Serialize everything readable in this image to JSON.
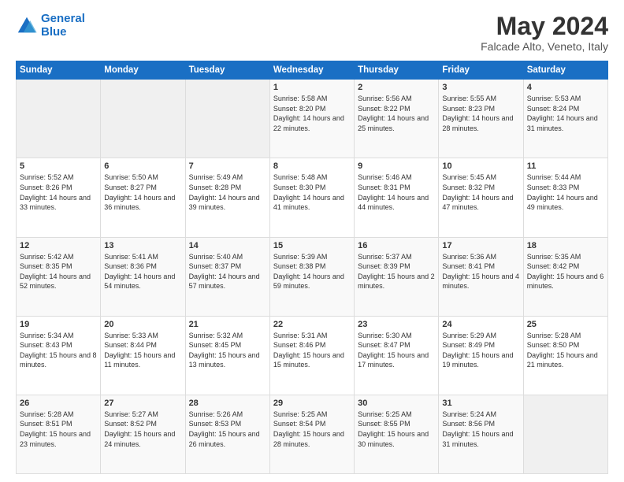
{
  "logo": {
    "line1": "General",
    "line2": "Blue"
  },
  "title": "May 2024",
  "subtitle": "Falcade Alto, Veneto, Italy",
  "weekdays": [
    "Sunday",
    "Monday",
    "Tuesday",
    "Wednesday",
    "Thursday",
    "Friday",
    "Saturday"
  ],
  "weeks": [
    [
      {
        "day": "",
        "sunrise": "",
        "sunset": "",
        "daylight": "",
        "empty": true
      },
      {
        "day": "",
        "sunrise": "",
        "sunset": "",
        "daylight": "",
        "empty": true
      },
      {
        "day": "",
        "sunrise": "",
        "sunset": "",
        "daylight": "",
        "empty": true
      },
      {
        "day": "1",
        "sunrise": "Sunrise: 5:58 AM",
        "sunset": "Sunset: 8:20 PM",
        "daylight": "Daylight: 14 hours and 22 minutes."
      },
      {
        "day": "2",
        "sunrise": "Sunrise: 5:56 AM",
        "sunset": "Sunset: 8:22 PM",
        "daylight": "Daylight: 14 hours and 25 minutes."
      },
      {
        "day": "3",
        "sunrise": "Sunrise: 5:55 AM",
        "sunset": "Sunset: 8:23 PM",
        "daylight": "Daylight: 14 hours and 28 minutes."
      },
      {
        "day": "4",
        "sunrise": "Sunrise: 5:53 AM",
        "sunset": "Sunset: 8:24 PM",
        "daylight": "Daylight: 14 hours and 31 minutes."
      }
    ],
    [
      {
        "day": "5",
        "sunrise": "Sunrise: 5:52 AM",
        "sunset": "Sunset: 8:26 PM",
        "daylight": "Daylight: 14 hours and 33 minutes."
      },
      {
        "day": "6",
        "sunrise": "Sunrise: 5:50 AM",
        "sunset": "Sunset: 8:27 PM",
        "daylight": "Daylight: 14 hours and 36 minutes."
      },
      {
        "day": "7",
        "sunrise": "Sunrise: 5:49 AM",
        "sunset": "Sunset: 8:28 PM",
        "daylight": "Daylight: 14 hours and 39 minutes."
      },
      {
        "day": "8",
        "sunrise": "Sunrise: 5:48 AM",
        "sunset": "Sunset: 8:30 PM",
        "daylight": "Daylight: 14 hours and 41 minutes."
      },
      {
        "day": "9",
        "sunrise": "Sunrise: 5:46 AM",
        "sunset": "Sunset: 8:31 PM",
        "daylight": "Daylight: 14 hours and 44 minutes."
      },
      {
        "day": "10",
        "sunrise": "Sunrise: 5:45 AM",
        "sunset": "Sunset: 8:32 PM",
        "daylight": "Daylight: 14 hours and 47 minutes."
      },
      {
        "day": "11",
        "sunrise": "Sunrise: 5:44 AM",
        "sunset": "Sunset: 8:33 PM",
        "daylight": "Daylight: 14 hours and 49 minutes."
      }
    ],
    [
      {
        "day": "12",
        "sunrise": "Sunrise: 5:42 AM",
        "sunset": "Sunset: 8:35 PM",
        "daylight": "Daylight: 14 hours and 52 minutes."
      },
      {
        "day": "13",
        "sunrise": "Sunrise: 5:41 AM",
        "sunset": "Sunset: 8:36 PM",
        "daylight": "Daylight: 14 hours and 54 minutes."
      },
      {
        "day": "14",
        "sunrise": "Sunrise: 5:40 AM",
        "sunset": "Sunset: 8:37 PM",
        "daylight": "Daylight: 14 hours and 57 minutes."
      },
      {
        "day": "15",
        "sunrise": "Sunrise: 5:39 AM",
        "sunset": "Sunset: 8:38 PM",
        "daylight": "Daylight: 14 hours and 59 minutes."
      },
      {
        "day": "16",
        "sunrise": "Sunrise: 5:37 AM",
        "sunset": "Sunset: 8:39 PM",
        "daylight": "Daylight: 15 hours and 2 minutes."
      },
      {
        "day": "17",
        "sunrise": "Sunrise: 5:36 AM",
        "sunset": "Sunset: 8:41 PM",
        "daylight": "Daylight: 15 hours and 4 minutes."
      },
      {
        "day": "18",
        "sunrise": "Sunrise: 5:35 AM",
        "sunset": "Sunset: 8:42 PM",
        "daylight": "Daylight: 15 hours and 6 minutes."
      }
    ],
    [
      {
        "day": "19",
        "sunrise": "Sunrise: 5:34 AM",
        "sunset": "Sunset: 8:43 PM",
        "daylight": "Daylight: 15 hours and 8 minutes."
      },
      {
        "day": "20",
        "sunrise": "Sunrise: 5:33 AM",
        "sunset": "Sunset: 8:44 PM",
        "daylight": "Daylight: 15 hours and 11 minutes."
      },
      {
        "day": "21",
        "sunrise": "Sunrise: 5:32 AM",
        "sunset": "Sunset: 8:45 PM",
        "daylight": "Daylight: 15 hours and 13 minutes."
      },
      {
        "day": "22",
        "sunrise": "Sunrise: 5:31 AM",
        "sunset": "Sunset: 8:46 PM",
        "daylight": "Daylight: 15 hours and 15 minutes."
      },
      {
        "day": "23",
        "sunrise": "Sunrise: 5:30 AM",
        "sunset": "Sunset: 8:47 PM",
        "daylight": "Daylight: 15 hours and 17 minutes."
      },
      {
        "day": "24",
        "sunrise": "Sunrise: 5:29 AM",
        "sunset": "Sunset: 8:49 PM",
        "daylight": "Daylight: 15 hours and 19 minutes."
      },
      {
        "day": "25",
        "sunrise": "Sunrise: 5:28 AM",
        "sunset": "Sunset: 8:50 PM",
        "daylight": "Daylight: 15 hours and 21 minutes."
      }
    ],
    [
      {
        "day": "26",
        "sunrise": "Sunrise: 5:28 AM",
        "sunset": "Sunset: 8:51 PM",
        "daylight": "Daylight: 15 hours and 23 minutes."
      },
      {
        "day": "27",
        "sunrise": "Sunrise: 5:27 AM",
        "sunset": "Sunset: 8:52 PM",
        "daylight": "Daylight: 15 hours and 24 minutes."
      },
      {
        "day": "28",
        "sunrise": "Sunrise: 5:26 AM",
        "sunset": "Sunset: 8:53 PM",
        "daylight": "Daylight: 15 hours and 26 minutes."
      },
      {
        "day": "29",
        "sunrise": "Sunrise: 5:25 AM",
        "sunset": "Sunset: 8:54 PM",
        "daylight": "Daylight: 15 hours and 28 minutes."
      },
      {
        "day": "30",
        "sunrise": "Sunrise: 5:25 AM",
        "sunset": "Sunset: 8:55 PM",
        "daylight": "Daylight: 15 hours and 30 minutes."
      },
      {
        "day": "31",
        "sunrise": "Sunrise: 5:24 AM",
        "sunset": "Sunset: 8:56 PM",
        "daylight": "Daylight: 15 hours and 31 minutes."
      },
      {
        "day": "",
        "sunrise": "",
        "sunset": "",
        "daylight": "",
        "empty": true
      }
    ]
  ]
}
